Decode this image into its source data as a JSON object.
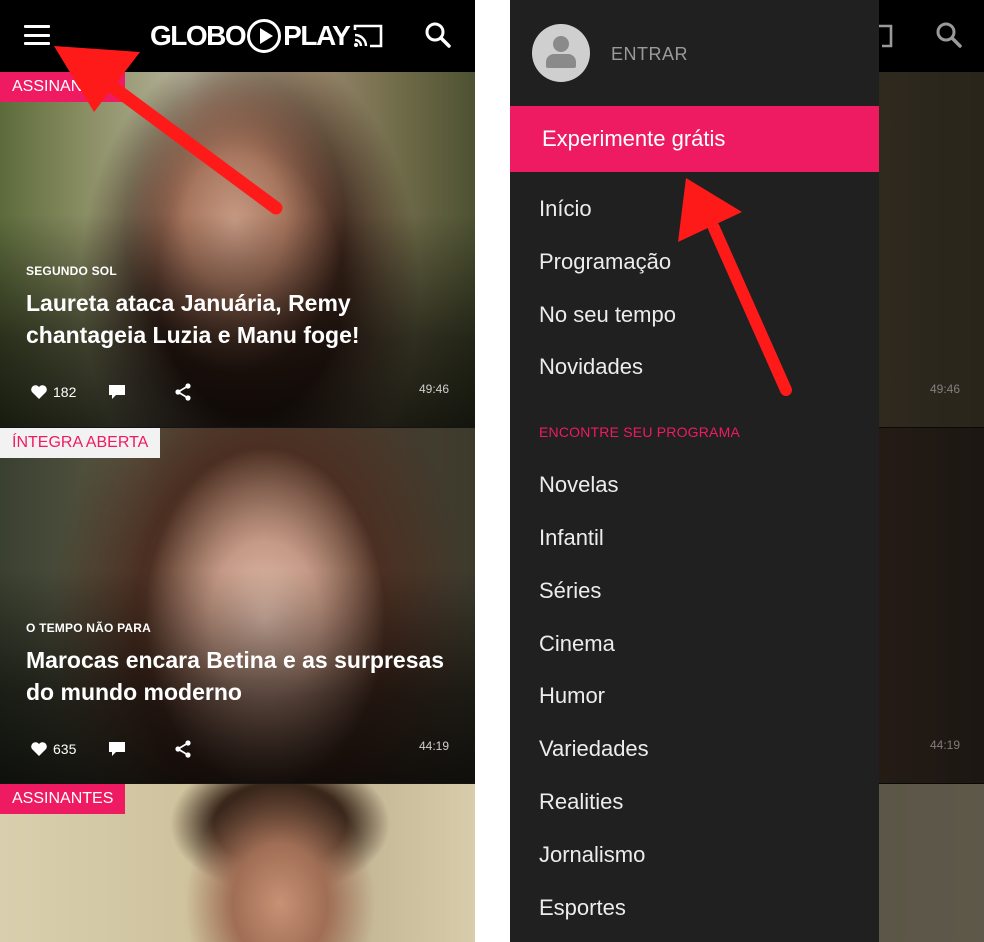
{
  "left": {
    "logo": {
      "part1": "GLOBO",
      "part2": "PLAY"
    },
    "cards": [
      {
        "badge": "ASSINANTES",
        "kicker": "SEGUNDO SOL",
        "title": "Laureta ataca Januária, Remy chantageia Luzia e Manu foge!",
        "likes": "182",
        "duration": "49:46"
      },
      {
        "badge": "ÍNTEGRA ABERTA",
        "kicker": "O TEMPO NÃO PARA",
        "title": "Marocas encara Betina e as surpresas do mundo moderno",
        "likes": "635",
        "duration": "44:19"
      },
      {
        "badge": "ASSINANTES"
      }
    ]
  },
  "right": {
    "bg_durations": [
      "49:46",
      "44:19"
    ],
    "drawer": {
      "login": "ENTRAR",
      "trial": "Experimente grátis",
      "nav": [
        "Início",
        "Programação",
        "No seu tempo",
        "Novidades"
      ],
      "section": "ENCONTRE SEU PROGRAMA",
      "categories": [
        "Novelas",
        "Infantil",
        "Séries",
        "Cinema",
        "Humor",
        "Variedades",
        "Realities",
        "Jornalismo",
        "Esportes"
      ]
    }
  },
  "colors": {
    "accent": "#ee1b63",
    "arrow": "#ff1a1a",
    "drawer": "#202020",
    "topbar": "#000000"
  },
  "icons": [
    "menu-icon",
    "cast-icon",
    "search-icon",
    "heart-icon",
    "comment-icon",
    "share-icon",
    "user-avatar-icon",
    "arrow-annotation"
  ]
}
